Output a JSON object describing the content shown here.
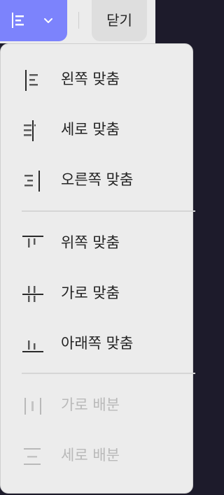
{
  "toolbar": {
    "align_icon": "align-left-icon",
    "chevron_icon": "chevron-down-icon",
    "close_label": "닫기"
  },
  "menu": {
    "items": [
      {
        "label": "왼쪽 맞춤",
        "icon": "align-left-icon",
        "enabled": true
      },
      {
        "label": "세로 맞춤",
        "icon": "align-center-vertical-icon",
        "enabled": true
      },
      {
        "label": "오른쪽 맞춤",
        "icon": "align-right-icon",
        "enabled": true
      },
      {
        "label": "위쪽 맞춤",
        "icon": "align-top-icon",
        "enabled": true
      },
      {
        "label": "가로 맞춤",
        "icon": "align-center-horizontal-icon",
        "enabled": true
      },
      {
        "label": "아래쪽 맞춤",
        "icon": "align-bottom-icon",
        "enabled": true
      },
      {
        "label": "가로 배분",
        "icon": "distribute-horizontal-icon",
        "enabled": false
      },
      {
        "label": "세로 배분",
        "icon": "distribute-vertical-icon",
        "enabled": false
      }
    ]
  },
  "colors": {
    "accent": "#7c83fc",
    "menu_bg": "#ececec",
    "text": "#232323",
    "disabled_text": "#b9b9b9",
    "page_bg": "#1d1b2b"
  }
}
